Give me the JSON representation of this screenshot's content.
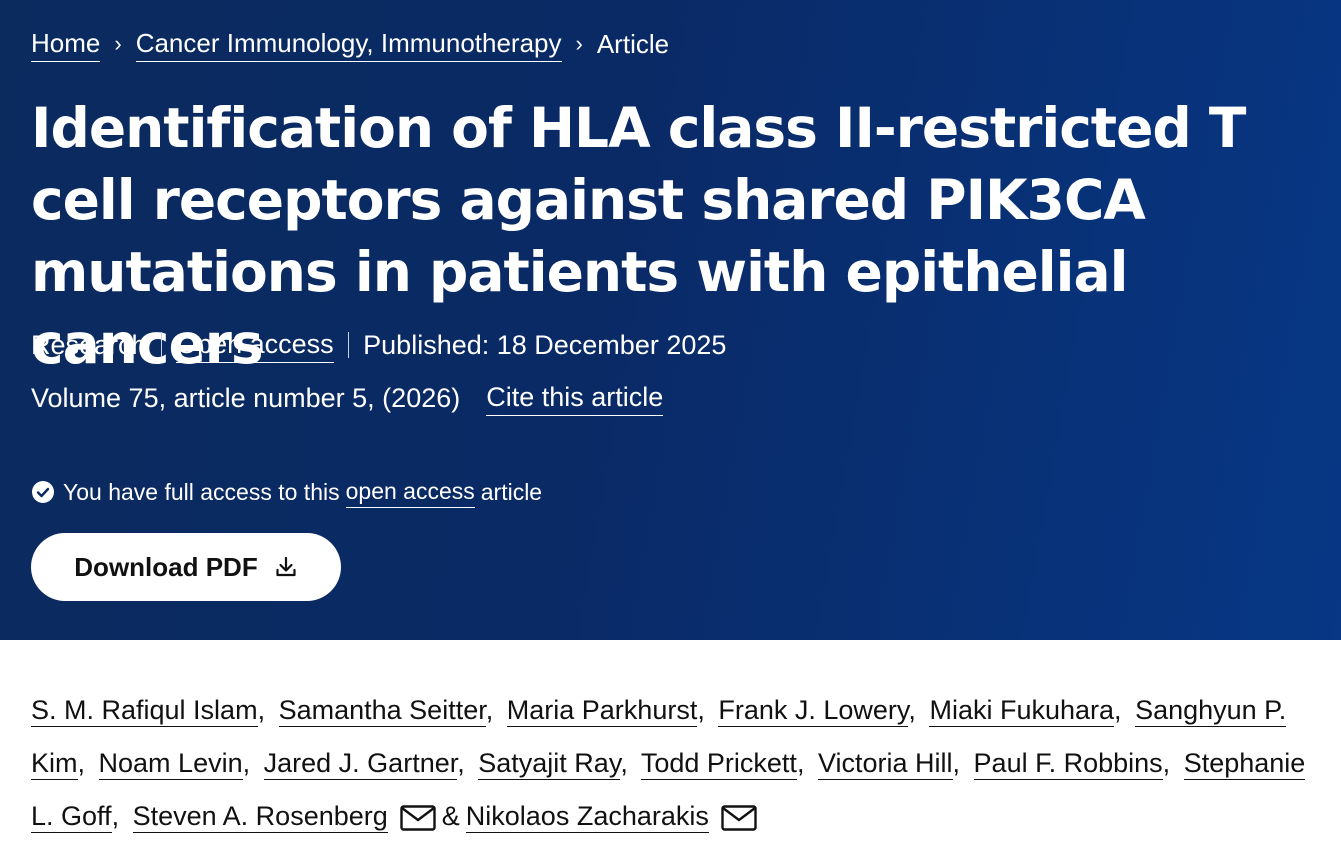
{
  "breadcrumb": {
    "items": [
      {
        "label": "Home"
      },
      {
        "label": "Cancer Immunology, Immunotherapy"
      },
      {
        "label": "Article"
      }
    ],
    "separator_icon": "chevron-right-icon"
  },
  "article": {
    "title": "Identification of HLA class II-restricted T cell receptors against shared PIK3CA mutations in patients with epithelial cancers",
    "type": "Research",
    "access": "Open access",
    "published": "Published: 18 December 2025",
    "volume_info": "Volume 75, article number 5, (2026)",
    "cite_label": "Cite this article"
  },
  "access_notice": {
    "icon": "check-circle-icon",
    "prefix": "You have full access to this",
    "link": "open access",
    "suffix": "article"
  },
  "download": {
    "label": "Download PDF",
    "icon": "download-icon"
  },
  "authors": [
    "S. M. Rafiqul Islam",
    "Samantha Seitter",
    "Maria Parkhurst",
    "Frank J. Lowery",
    "Miaki Fukuhara",
    "Sanghyun P. Kim",
    "Noam Levin",
    "Jared J. Gartner",
    "Satyajit Ray",
    "Todd Prickett",
    "Victoria Hill",
    "Paul F. Robbins",
    "Stephanie L. Goff",
    "Steven A. Rosenberg",
    "Nikolaos Zacharakis"
  ],
  "authors_connector": "&",
  "colors": {
    "hero_background": "#0a2a66",
    "text_on_hero": "#ffffff",
    "body_text": "#111111"
  }
}
